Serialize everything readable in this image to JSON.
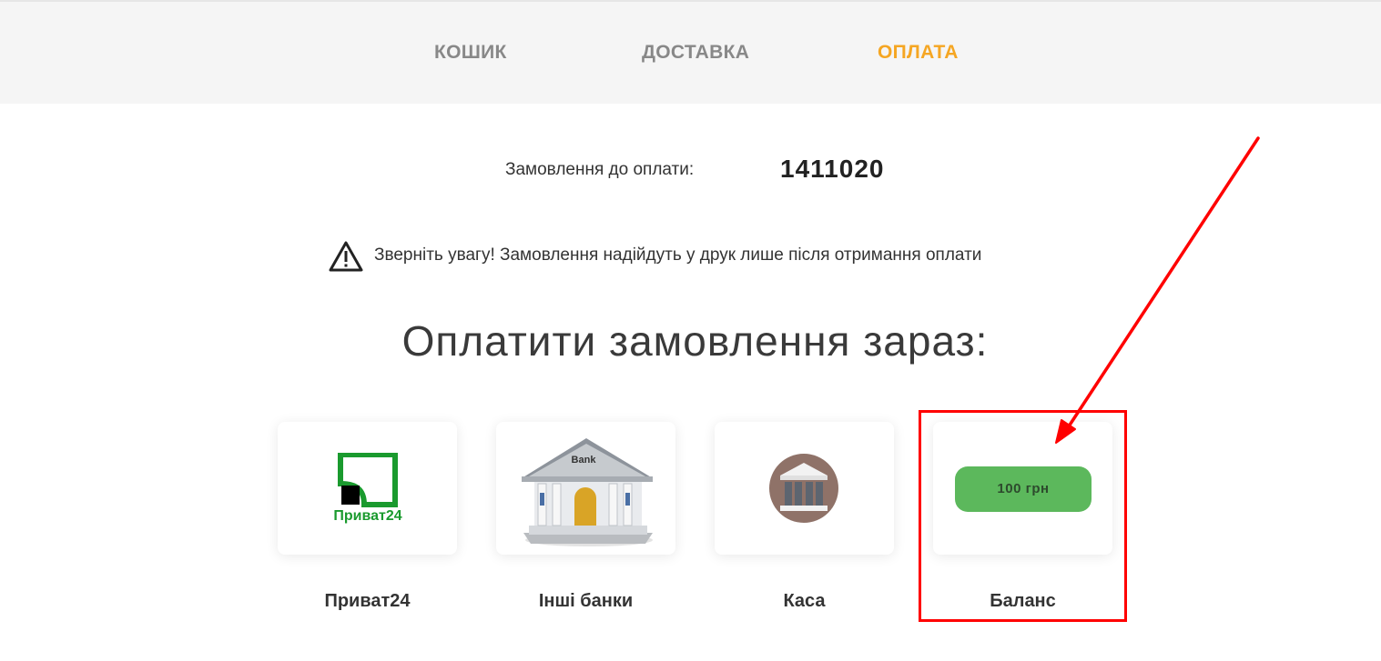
{
  "steps": {
    "cart": "КОШИК",
    "delivery": "ДОСТАВКА",
    "payment": "ОПЛАТА"
  },
  "order": {
    "label": "Замовлення до оплати:",
    "number": "1411020"
  },
  "notice": {
    "icon": "warning-triangle-icon",
    "text": "Зверніть увагу! Замовлення надійдуть у друк лише після отримання оплати"
  },
  "payment": {
    "title": "Оплатити замовлення зараз:",
    "methods": [
      {
        "label": "Приват24",
        "logo_text": "Приват24",
        "icon": "privat24-logo"
      },
      {
        "label": "Інші банки",
        "logo_text": "Bank",
        "icon": "bank-building-icon"
      },
      {
        "label": "Каса",
        "icon": "cashier-building-icon"
      },
      {
        "label": "Баланс",
        "pill_text": "100 грн",
        "icon": "balance-pill"
      }
    ]
  },
  "colors": {
    "active_step": "#f5a623",
    "inactive_step": "#888888",
    "privat_green": "#1a9a2e",
    "balance_green": "#5cb85c",
    "annotation_red": "#ff0000"
  }
}
